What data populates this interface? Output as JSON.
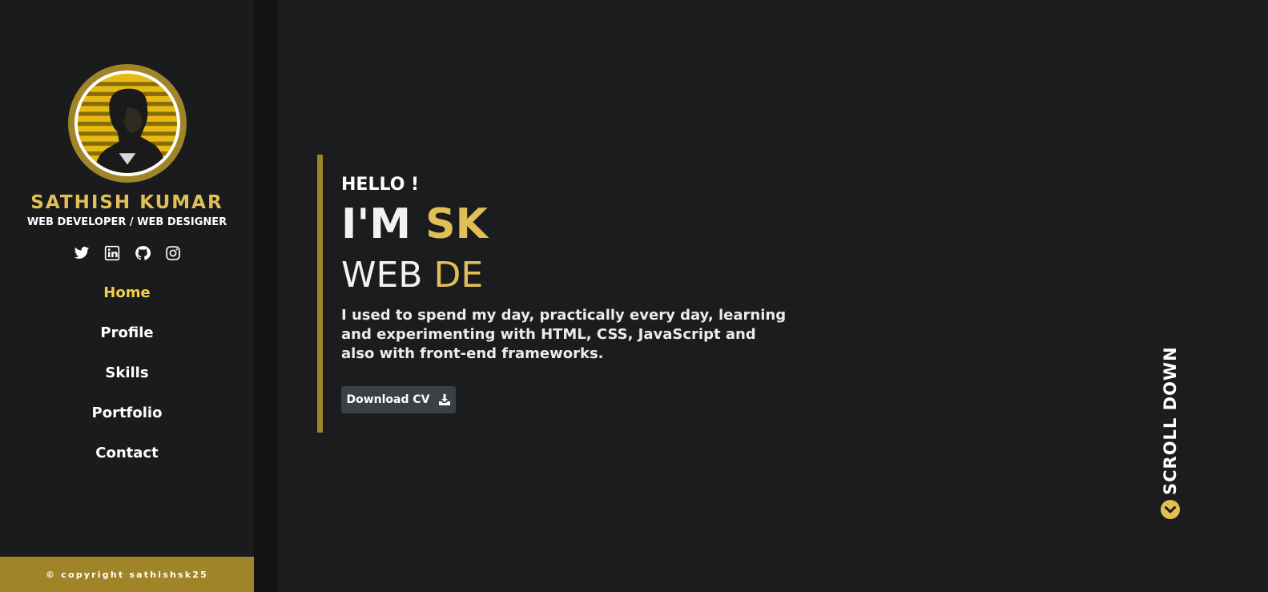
{
  "sidebar": {
    "name": "SATHISH KUMAR",
    "role": "WEB DEVELOPER / WEB DESIGNER",
    "socials": [
      "twitter-icon",
      "linkedin-icon",
      "github-icon",
      "instagram-icon"
    ],
    "nav": [
      {
        "label": "Home",
        "active": true
      },
      {
        "label": "Profile",
        "active": false
      },
      {
        "label": "Skills",
        "active": false
      },
      {
        "label": "Portfolio",
        "active": false
      },
      {
        "label": "Contact",
        "active": false
      }
    ],
    "copyright": "© copyright sathishsk25"
  },
  "hero": {
    "greeting": "HELLO !",
    "intro_prefix": "I'M ",
    "intro_highlight": "SK",
    "typed_prefix": "WEB ",
    "typed_highlight": "DE",
    "description": "I used to spend my day, practically every day, learning and experimenting with HTML, CSS, JavaScript and also with front-end frameworks.",
    "cv_button": "Download CV"
  },
  "scroll": {
    "label": "SCROLL DOWN"
  },
  "colors": {
    "accent": "#e2bf55",
    "accent_dark": "#a08428",
    "background": "#1b1c1e"
  }
}
